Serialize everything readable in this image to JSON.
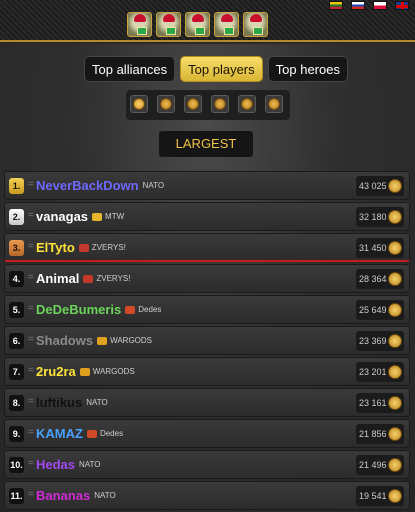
{
  "header": {
    "flags": [
      "lt",
      "ru",
      "pl",
      "en"
    ],
    "game_icons": [
      "game-1-icon",
      "game-2-icon",
      "game-3-icon",
      "game-4-icon",
      "game-5-icon"
    ]
  },
  "tabs": [
    {
      "label": "Top alliances",
      "active": false
    },
    {
      "label": "Top players",
      "active": true
    },
    {
      "label": "Top heroes",
      "active": false
    }
  ],
  "categories": [
    "coin-icon",
    "swords-icon",
    "shield-icon",
    "bag-icon",
    "orb-icon",
    "medal-icon"
  ],
  "section_label": "LARGEST",
  "players": [
    {
      "rank": "1.",
      "name": "NeverBackDown",
      "name_color": "#6f68ff",
      "alliance": "NATO",
      "emblem": "",
      "score": "43 025",
      "style": "gold"
    },
    {
      "rank": "2.",
      "name": "vanagas",
      "name_color": "#ffffff",
      "alliance": "MTW",
      "emblem": "#e7b52b",
      "score": "32 180",
      "style": "silver"
    },
    {
      "rank": "3.",
      "name": "ElTyto",
      "name_color": "#ffe23a",
      "alliance": "ZVERYS!",
      "emblem": "#c0392b",
      "score": "31 450",
      "style": "bronze"
    },
    {
      "rank": "4.",
      "name": "Animal",
      "name_color": "#ffffff",
      "alliance": "ZVERYS!",
      "emblem": "#c0392b",
      "score": "28 364",
      "style": "plain"
    },
    {
      "rank": "5.",
      "name": "DeDeBumeris",
      "name_color": "#6bd45a",
      "alliance": "Dedes",
      "emblem": "#d04a2a",
      "score": "25 649",
      "style": "plain"
    },
    {
      "rank": "6.",
      "name": "Shadows",
      "name_color": "#8b8b8b",
      "alliance": "WARGODS",
      "emblem": "#e0a020",
      "score": "23 369",
      "style": "plain"
    },
    {
      "rank": "7.",
      "name": "2ru2ra",
      "name_color": "#ffe23a",
      "alliance": "WARGODS",
      "emblem": "#e0a020",
      "score": "23 201",
      "style": "plain"
    },
    {
      "rank": "8.",
      "name": "luftikus",
      "name_color": "#111111",
      "alliance": "NATO",
      "emblem": "",
      "score": "23 161",
      "style": "plain"
    },
    {
      "rank": "9.",
      "name": "KAMAZ",
      "name_color": "#4aa0ff",
      "alliance": "Dedes",
      "emblem": "#d04a2a",
      "score": "21 856",
      "style": "plain"
    },
    {
      "rank": "10.",
      "name": "Hedas",
      "name_color": "#a04bf0",
      "alliance": "NATO",
      "emblem": "",
      "score": "21 496",
      "style": "plain"
    },
    {
      "rank": "11.",
      "name": "Bananas",
      "name_color": "#d02bd6",
      "alliance": "NATO",
      "emblem": "",
      "score": "19 541",
      "style": "plain"
    }
  ]
}
